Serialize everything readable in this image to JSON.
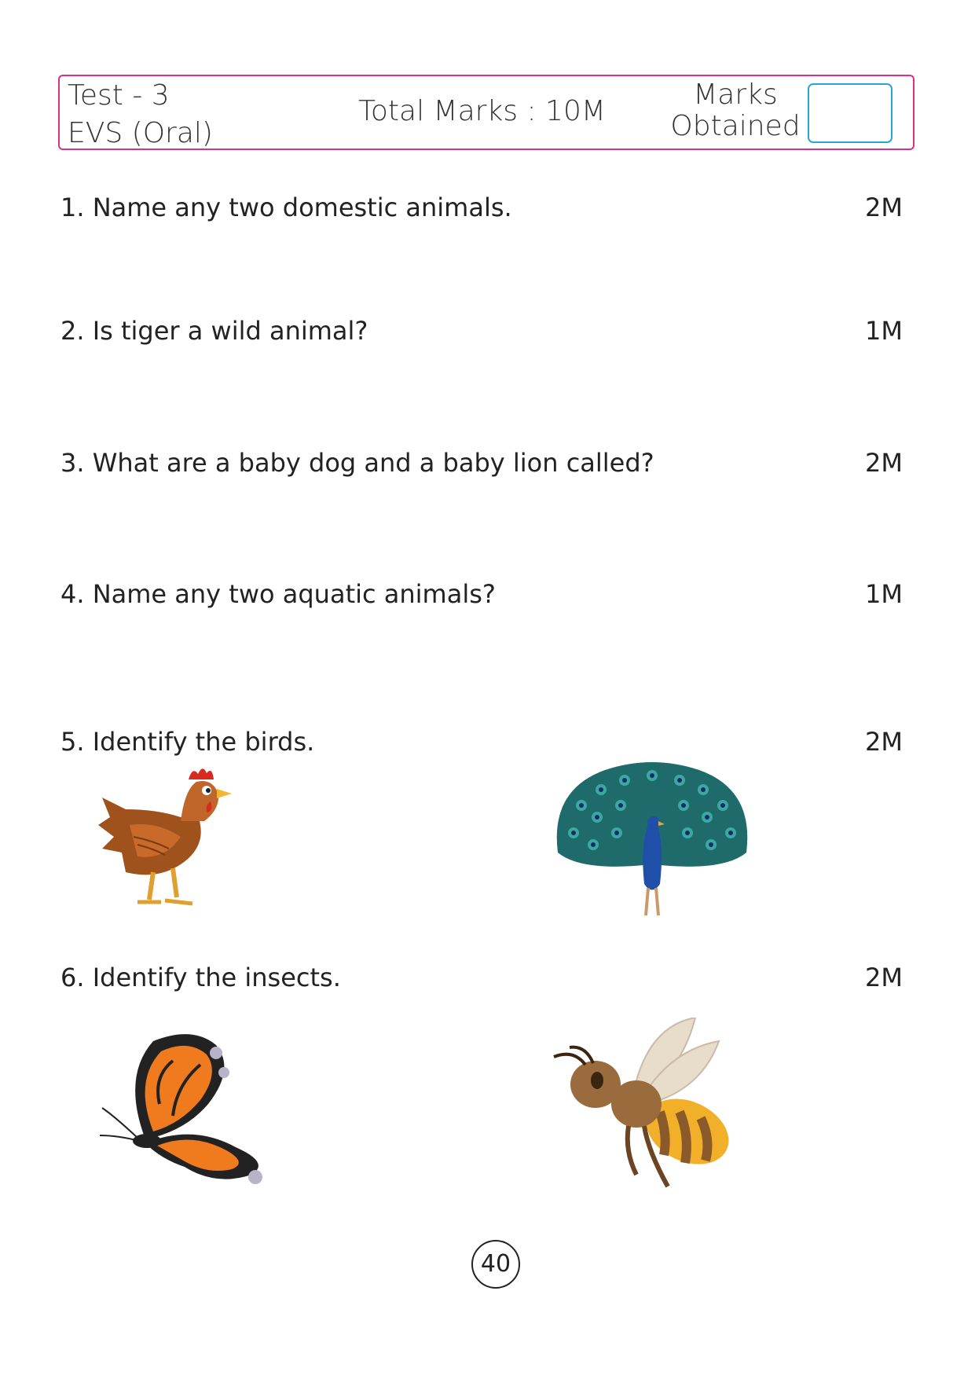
{
  "header": {
    "test_no": "Test - 3",
    "subject": "EVS (Oral)",
    "total_marks": "Total Marks : 10M",
    "marks_obtained_label": "Marks Obtained"
  },
  "questions": [
    {
      "text": "1. Name any two domestic animals.",
      "marks": "2M"
    },
    {
      "text": "2.  Is tiger a wild animal?",
      "marks": "1M"
    },
    {
      "text": "3.  What are a baby dog and a baby lion called?",
      "marks": "2M"
    },
    {
      "text": "4. Name any two aquatic animals?",
      "marks": "1M"
    },
    {
      "text": "5. Identify the birds.",
      "marks": "2M",
      "images": [
        "hen",
        "peacock"
      ]
    },
    {
      "text": "6. Identify the insects.",
      "marks": "2M",
      "images": [
        "butterfly",
        "honey-bee"
      ]
    }
  ],
  "page_number": "40",
  "colors": {
    "header_border": "#d63384",
    "marks_box_border": "#2aa6d6"
  }
}
